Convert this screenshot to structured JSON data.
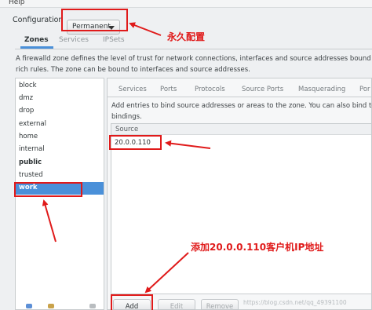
{
  "menubar": {
    "help_label": "Help"
  },
  "config": {
    "label": "Configuration",
    "mode_value": "Permanent"
  },
  "main_tabs": [
    {
      "label": "Zones",
      "active": true
    },
    {
      "label": "Services",
      "active": false
    },
    {
      "label": "IPSets",
      "active": false
    }
  ],
  "description": {
    "line1": "A firewalld zone defines the level of trust for network connections, interfaces and source addresses bound to the",
    "line2": "rich rules. The zone can be bound to interfaces and source addresses."
  },
  "zones": [
    {
      "label": "block"
    },
    {
      "label": "dmz"
    },
    {
      "label": "drop"
    },
    {
      "label": "external"
    },
    {
      "label": "home"
    },
    {
      "label": "internal"
    },
    {
      "label": "public"
    },
    {
      "label": "trusted"
    },
    {
      "label": "work"
    }
  ],
  "selected_zone": "work",
  "zone_subtabs": [
    {
      "label": "Services"
    },
    {
      "label": "Ports"
    },
    {
      "label": "Protocols"
    },
    {
      "label": "Source Ports"
    },
    {
      "label": "Masquerading"
    },
    {
      "label": "Por"
    }
  ],
  "sources": {
    "description_line1": "Add entries to bind source addresses or areas to the zone. You can also bind to a M",
    "description_line2": "bindings.",
    "column_header": "Source",
    "rows": [
      {
        "value": "20.0.0.110"
      }
    ],
    "buttons": {
      "add": "Add",
      "edit": "Edit",
      "remove": "Remove"
    }
  },
  "annotations": {
    "permanent_note": "永久配置",
    "add_ip_note": "添加20.0.0.110客户机IP地址"
  },
  "watermark": "https://blog.csdn.net/qq_49391100",
  "colors": {
    "selection": "#4a90d9",
    "annotation": "#e01a1a"
  }
}
